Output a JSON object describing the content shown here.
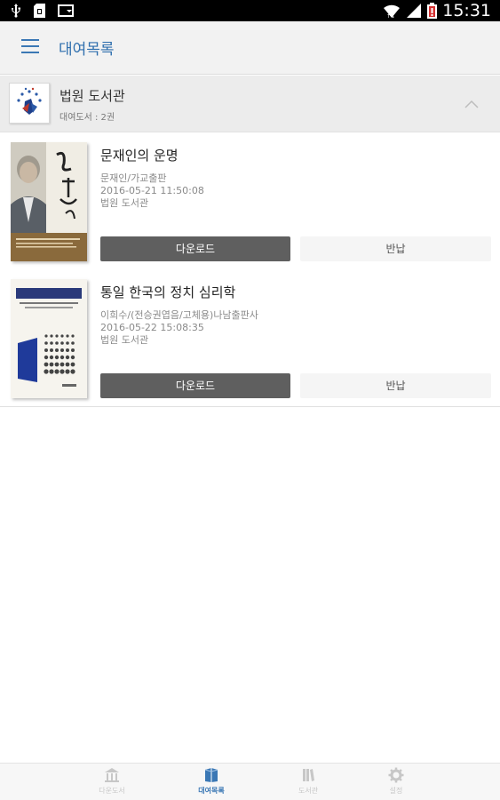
{
  "status_bar": {
    "time": "15:31",
    "icons": [
      "usb-icon",
      "sd-card-icon",
      "cast-icon",
      "wifi-icon",
      "signal-icon",
      "battery-icon"
    ]
  },
  "app_bar": {
    "title": "대여목록",
    "menu_icon": "hamburger-menu-icon",
    "accent_color": "#2f6fae"
  },
  "library_group": {
    "name": "법원 도서관",
    "count_label": "대여도서 : 2권",
    "logo_icon": "court-library-logo",
    "chevron_icon": "chevron-up-icon"
  },
  "books": [
    {
      "title": "문재인의 운명",
      "author_publisher": "문재인/가교출판",
      "datetime": "2016-05-21 11:50:08",
      "library": "법원 도서관",
      "download_label": "다운로드",
      "return_label": "반납"
    },
    {
      "title": "통일 한국의 정치 심리학",
      "author_publisher": "이희수/(전승권엽음/고체용)나남출판사",
      "datetime": "2016-05-22 15:08:35",
      "library": "법원 도서관",
      "download_label": "다운로드",
      "return_label": "반납"
    }
  ],
  "bottom_nav": [
    {
      "label": "다운도서",
      "icon": "library-building-icon",
      "active": false
    },
    {
      "label": "대여목록",
      "icon": "book-icon",
      "active": true
    },
    {
      "label": "도서관",
      "icon": "bookshelf-icon",
      "active": false
    },
    {
      "label": "설정",
      "icon": "gear-icon",
      "active": false
    }
  ]
}
